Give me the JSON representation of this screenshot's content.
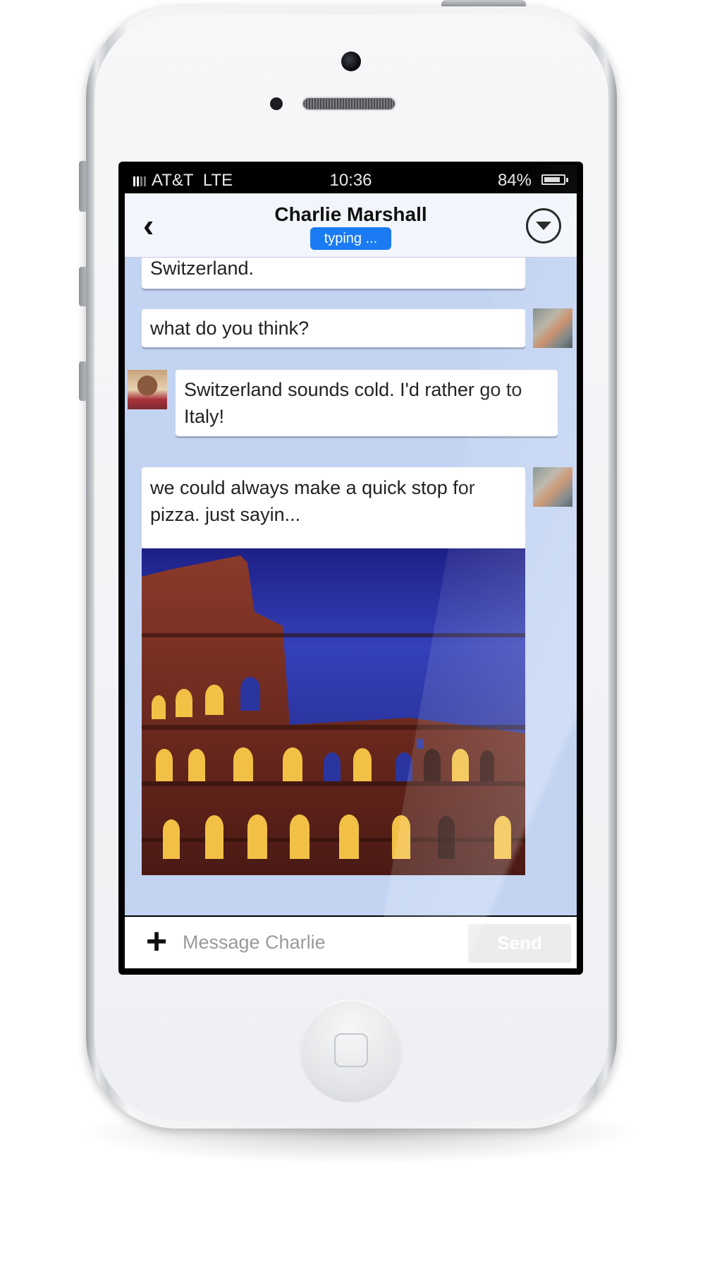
{
  "status_bar": {
    "carrier": "AT&T",
    "network": "LTE",
    "time": "10:36",
    "battery": "84%"
  },
  "nav": {
    "back_icon": "chevron-left-icon",
    "title": "Charlie Marshall",
    "status": "typing ...",
    "menu_icon": "chevron-down-circle-icon"
  },
  "messages": [
    {
      "sender": "me",
      "text": "Switzerland."
    },
    {
      "sender": "me",
      "text": "what do you think?"
    },
    {
      "sender": "charlie",
      "text": "Switzerland sounds cold. I'd rather go to Italy!"
    },
    {
      "sender": "me",
      "text": "we could always make a quick stop for pizza. just sayin...",
      "image": "colosseum-photo"
    }
  ],
  "composer": {
    "add_icon": "plus-icon",
    "placeholder": "Message Charlie",
    "send_label": "Send"
  },
  "colors": {
    "chat_background": "#c3d4f2",
    "typing_badge": "#1a7bf2",
    "send_button": "#ececec"
  }
}
